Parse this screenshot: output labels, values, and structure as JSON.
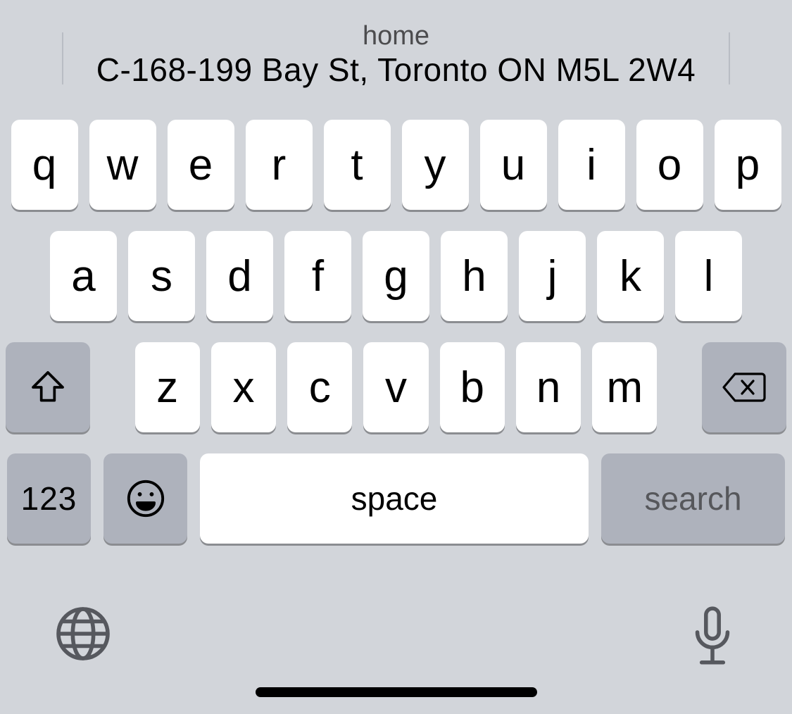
{
  "suggestion": {
    "title": "home",
    "subtitle": "C-168-199 Bay St, Toronto ON M5L 2W4"
  },
  "keys": {
    "row1": [
      "q",
      "w",
      "e",
      "r",
      "t",
      "y",
      "u",
      "i",
      "o",
      "p"
    ],
    "row2": [
      "a",
      "s",
      "d",
      "f",
      "g",
      "h",
      "j",
      "k",
      "l"
    ],
    "row3": [
      "z",
      "x",
      "c",
      "v",
      "b",
      "n",
      "m"
    ],
    "numbers": "123",
    "space": "space",
    "search": "search"
  },
  "icons": {
    "shift": "shift-icon",
    "backspace": "backspace-icon",
    "emoji": "emoji-icon",
    "globe": "globe-icon",
    "mic": "mic-icon"
  }
}
